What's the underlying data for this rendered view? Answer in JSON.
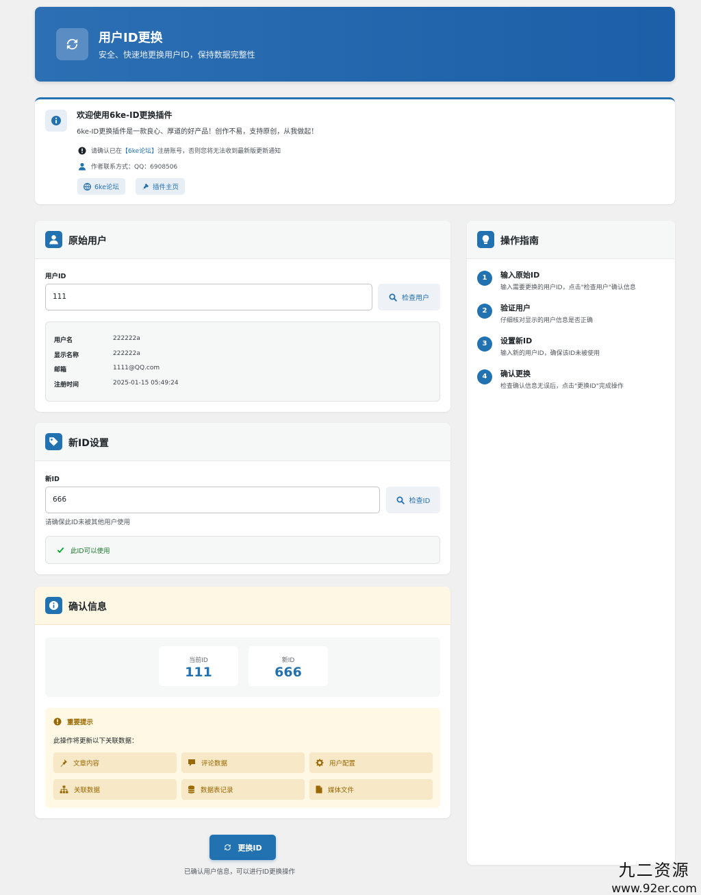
{
  "header": {
    "title": "用户ID更换",
    "subtitle": "安全、快速地更换用户ID，保持数据完整性",
    "icon": "sync-icon"
  },
  "welcome": {
    "title": "欢迎使用6ke-ID更换插件",
    "desc": "6ke-ID更换插件是一款良心、厚道的好产品！创作不易，支持原创，从我做起！",
    "notice_prefix": "请确认已在",
    "notice_link": "【6ke论坛】",
    "notice_suffix": "注册账号，否则您将无法收到最新版更新通知",
    "contact": "作者联系方式：QQ：6908506",
    "forum_button": "6ke论坛",
    "plugin_button": "插件主页"
  },
  "original_user": {
    "title": "原始用户",
    "field_label": "用户ID",
    "field_value": "111",
    "check_button": "检查用户",
    "info": [
      {
        "key": "用户名",
        "value": "222222a"
      },
      {
        "key": "显示名称",
        "value": "222222a"
      },
      {
        "key": "邮箱",
        "value": "1111@QQ.com"
      },
      {
        "key": "注册时间",
        "value": "2025-01-15 05:49:24"
      }
    ]
  },
  "new_id": {
    "title": "新ID设置",
    "field_label": "新ID",
    "field_value": "666",
    "check_button": "检查ID",
    "hint": "请确保此ID未被其他用户使用",
    "status": "此ID可以使用"
  },
  "confirm": {
    "title": "确认信息",
    "current_label": "当前ID",
    "current_value": "111",
    "new_label": "新ID",
    "new_value": "666",
    "warning_title": "重要提示",
    "warning_desc": "此操作将更新以下关联数据：",
    "items": [
      "文章内容",
      "评论数据",
      "用户配置",
      "关联数据",
      "数据表记录",
      "媒体文件"
    ]
  },
  "submit": {
    "label": "更换ID",
    "hint": "已确认用户信息，可以进行ID更换操作"
  },
  "guide": {
    "title": "操作指南",
    "steps": [
      {
        "num": "1",
        "title": "输入原始ID",
        "desc": "输入需要更换的用户ID，点击\"检查用户\"确认信息"
      },
      {
        "num": "2",
        "title": "验证用户",
        "desc": "仔细核对显示的用户信息是否正确"
      },
      {
        "num": "3",
        "title": "设置新ID",
        "desc": "输入新的用户ID，确保该ID未被使用"
      },
      {
        "num": "4",
        "title": "确认更换",
        "desc": "检查确认信息无误后，点击\"更换ID\"完成操作"
      }
    ]
  },
  "watermark": {
    "line1": "九二资源",
    "line2": "www.92er.com"
  },
  "colors": {
    "primary": "#2271b1",
    "header_bg": "#1d5fa8",
    "success": "#00a32a",
    "warning": "#996800",
    "warning_bg": "#fef8e4"
  }
}
